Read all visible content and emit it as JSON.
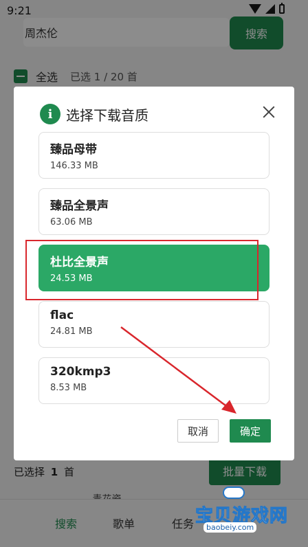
{
  "status_bar": {
    "time": "9:21"
  },
  "search": {
    "value": "周杰伦",
    "button_label": "搜索"
  },
  "select_all": {
    "label": "全选",
    "count_text": "已选 1 / 20 首"
  },
  "bottom": {
    "selected_prefix": "已选择",
    "selected_count": "1",
    "selected_suffix": "首",
    "batch_button": "批量下载"
  },
  "partial_row_text": "青花瓷",
  "tabs": [
    {
      "label": "搜索",
      "active": true
    },
    {
      "label": "歌单",
      "active": false
    },
    {
      "label": "任务",
      "active": false
    }
  ],
  "dialog": {
    "title": "选择下载音质",
    "info_icon": "i",
    "options": [
      {
        "name": "臻品母带",
        "size": "146.33 MB",
        "selected": false
      },
      {
        "name": "臻品全景声",
        "size": "63.06 MB",
        "selected": false
      },
      {
        "name": "杜比全景声",
        "size": "24.53 MB",
        "selected": true
      },
      {
        "name": "flac",
        "size": "24.81 MB",
        "selected": false
      },
      {
        "name": "320kmp3",
        "size": "8.53 MB",
        "selected": false
      }
    ],
    "cancel_label": "取消",
    "ok_label": "确定"
  },
  "colors": {
    "accent": "#1f8a4f",
    "selected_option": "#2ba866",
    "annotation": "#d9262c"
  },
  "watermark": {
    "title": "宝贝游戏网",
    "url": "baobeiy.com"
  }
}
